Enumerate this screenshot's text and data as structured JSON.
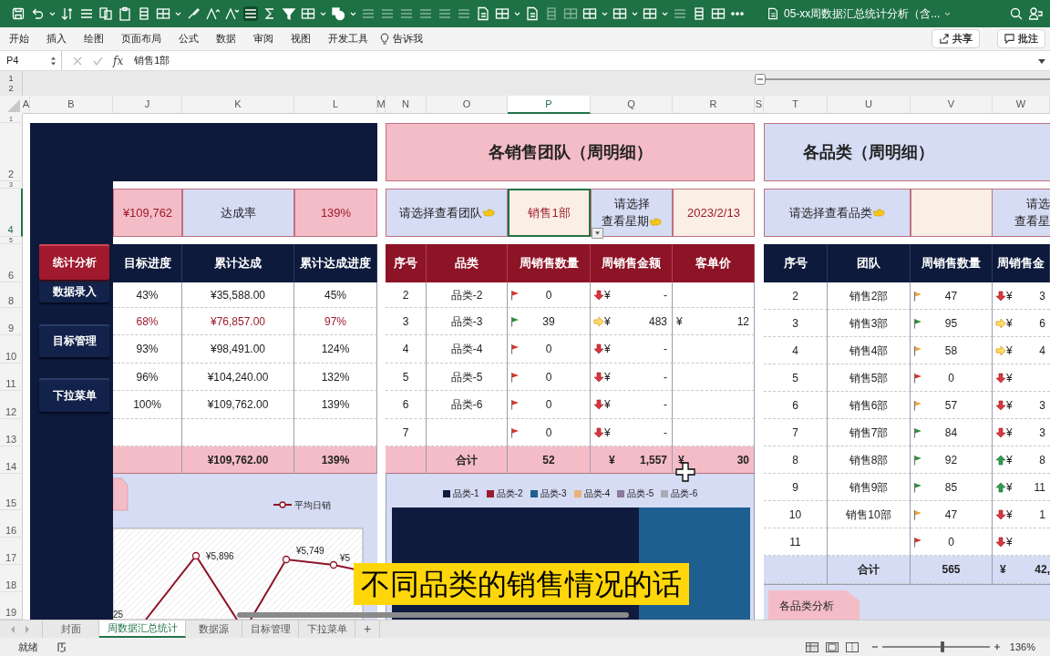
{
  "toolbar": {
    "file_title": "05-xx周数据汇总统计分析（含..."
  },
  "ribbon": {
    "tabs": [
      "开始",
      "插入",
      "绘图",
      "页面布局",
      "公式",
      "数据",
      "审阅",
      "视图",
      "开发工具"
    ],
    "tell_me": "告诉我",
    "share": "共享",
    "comments": "批注"
  },
  "formula_bar": {
    "name_box": "P4",
    "function_label": "fx",
    "formula": "销售1部"
  },
  "outline_levels": [
    "1",
    "2"
  ],
  "columns": [
    {
      "label": "A",
      "selected": false
    },
    {
      "label": "B",
      "selected": false
    },
    {
      "label": "J",
      "selected": false
    },
    {
      "label": "K",
      "selected": false
    },
    {
      "label": "L",
      "selected": false
    },
    {
      "label": "M",
      "selected": false
    },
    {
      "label": "N",
      "selected": false
    },
    {
      "label": "O",
      "selected": false
    },
    {
      "label": "P",
      "selected": true
    },
    {
      "label": "Q",
      "selected": false
    },
    {
      "label": "R",
      "selected": false
    },
    {
      "label": "S",
      "selected": false
    },
    {
      "label": "T",
      "selected": false
    },
    {
      "label": "U",
      "selected": false
    },
    {
      "label": "V",
      "selected": false
    },
    {
      "label": "W",
      "selected": false
    }
  ],
  "rows": [
    {
      "label": "1",
      "selected": false
    },
    {
      "label": "2",
      "selected": false
    },
    {
      "label": "3",
      "selected": false
    },
    {
      "label": "4",
      "selected": true
    },
    {
      "label": "5",
      "selected": false
    },
    {
      "label": "6",
      "selected": false
    },
    {
      "label": "8",
      "selected": false
    },
    {
      "label": "9",
      "selected": false
    },
    {
      "label": "10",
      "selected": false
    },
    {
      "label": "11",
      "selected": false
    },
    {
      "label": "12",
      "selected": false
    },
    {
      "label": "13",
      "selected": false
    },
    {
      "label": "14",
      "selected": false
    },
    {
      "label": "15",
      "selected": false
    },
    {
      "label": "16",
      "selected": false
    },
    {
      "label": "17",
      "selected": false
    },
    {
      "label": "18",
      "selected": false
    },
    {
      "label": "19",
      "selected": false
    }
  ],
  "nav_buttons": [
    {
      "label": "统计分析",
      "selected": true
    },
    {
      "label": "数据录入",
      "selected": false
    },
    {
      "label": "目标管理",
      "selected": false
    },
    {
      "label": "下拉菜单",
      "selected": false
    }
  ],
  "target_panel": {
    "amount": "¥109,762",
    "rate_label": "达成率",
    "rate": "139%",
    "columns": [
      "目标进度",
      "累计达成",
      "累计达成进度"
    ],
    "rows": [
      {
        "cells": [
          "43%",
          "¥35,588.00",
          "45%"
        ],
        "highlighted": false
      },
      {
        "cells": [
          "68%",
          "¥76,857.00",
          "97%"
        ],
        "highlighted": true
      },
      {
        "cells": [
          "93%",
          "¥98,491.00",
          "124%"
        ],
        "highlighted": false
      },
      {
        "cells": [
          "96%",
          "¥104,240.00",
          "132%"
        ],
        "highlighted": false
      },
      {
        "cells": [
          "100%",
          "¥109,762.00",
          "139%"
        ],
        "highlighted": false
      },
      {
        "cells": []
      }
    ],
    "total": {
      "achieved": "¥109,762.00",
      "progress": "139%"
    },
    "chart": {
      "legend": "平均日销",
      "labels": [
        "¥5,896",
        "¥5,749",
        "¥5",
        "25"
      ]
    }
  },
  "team_panel": {
    "title": "各销售团队（周明细）",
    "team_label": "请选择查看团队",
    "team_value": {
      "text": "销售1部",
      "selected": true
    },
    "week_label": [
      "请选择",
      "查看星期"
    ],
    "week_value": "2023/2/13",
    "columns": [
      "序号",
      "品类",
      "周销售数量",
      "周销售金额",
      "客单价"
    ],
    "rows": [
      {
        "no": "2",
        "name": "品类-2",
        "flag": {
          "color": "#d6332b"
        },
        "qty": "0",
        "trend": {
          "kind": "down"
        },
        "currency": "¥",
        "amount": "-"
      },
      {
        "no": "3",
        "name": "品类-3",
        "flag": {
          "color": "#2e8b3a"
        },
        "qty": "39",
        "trend": {
          "kind": "right"
        },
        "currency": "¥",
        "amount": "483",
        "price_currency": "¥",
        "price": "12"
      },
      {
        "no": "4",
        "name": "品类-4",
        "flag": {
          "color": "#d6332b"
        },
        "qty": "0",
        "trend": {
          "kind": "down"
        },
        "currency": "¥",
        "amount": "-"
      },
      {
        "no": "5",
        "name": "品类-5",
        "flag": {
          "color": "#d6332b"
        },
        "qty": "0",
        "trend": {
          "kind": "down"
        },
        "currency": "¥",
        "amount": "-"
      },
      {
        "no": "6",
        "name": "品类-6",
        "flag": {
          "color": "#d6332b"
        },
        "qty": "0",
        "trend": {
          "kind": "down"
        },
        "currency": "¥",
        "amount": "-"
      },
      {
        "no": "7",
        "flag": {
          "color": "#d6332b"
        },
        "qty": "0",
        "trend": {
          "kind": "down"
        },
        "currency": "¥",
        "amount": "-"
      }
    ],
    "total": {
      "label": "合计",
      "qty": "52",
      "currency": "¥",
      "amount": "1,557",
      "price_currency": "¥",
      "price": "30"
    },
    "legend": [
      {
        "label": "品类-1",
        "color": "#101c3f"
      },
      {
        "label": "品类-2",
        "color": "#9b1b2e"
      },
      {
        "label": "品类-3",
        "color": "#1f5f8f"
      },
      {
        "label": "品类-4",
        "color": "#e8b27a"
      },
      {
        "label": "品类-5",
        "color": "#8c7b9c"
      },
      {
        "label": "品类-6",
        "color": "#a9adb3"
      }
    ]
  },
  "category_panel": {
    "title": "各品类（周明细）",
    "category_label": "请选择查看品类",
    "week_label": [
      "请选",
      "查看星"
    ],
    "columns": [
      "序号",
      "团队",
      "周销售数量",
      "周销售金"
    ],
    "rows": [
      {
        "no": "2",
        "team": "销售2部",
        "flag": {
          "color": "#e8a63a"
        },
        "qty": "47",
        "trend": {
          "kind": "down"
        },
        "currency": "¥",
        "amount": "3"
      },
      {
        "no": "3",
        "team": "销售3部",
        "flag": {
          "color": "#2e8b3a"
        },
        "qty": "95",
        "trend": {
          "kind": "right"
        },
        "currency": "¥",
        "amount": "6"
      },
      {
        "no": "4",
        "team": "销售4部",
        "flag": {
          "color": "#e8a63a"
        },
        "qty": "58",
        "trend": {
          "kind": "right"
        },
        "currency": "¥",
        "amount": "4"
      },
      {
        "no": "5",
        "team": "销售5部",
        "flag": {
          "color": "#d6332b"
        },
        "qty": "0",
        "trend": {
          "kind": "down"
        },
        "currency": "¥"
      },
      {
        "no": "6",
        "team": "销售6部",
        "flag": {
          "color": "#e8a63a"
        },
        "qty": "57",
        "trend": {
          "kind": "down"
        },
        "currency": "¥",
        "amount": "3"
      },
      {
        "no": "7",
        "team": "销售7部",
        "flag": {
          "color": "#2e8b3a"
        },
        "qty": "84",
        "trend": {
          "kind": "down"
        },
        "currency": "¥",
        "amount": "3"
      },
      {
        "no": "8",
        "team": "销售8部",
        "flag": {
          "color": "#2e8b3a"
        },
        "qty": "92",
        "trend": {
          "kind": "up"
        },
        "currency": "¥",
        "amount": "8"
      },
      {
        "no": "9",
        "team": "销售9部",
        "flag": {
          "color": "#2e8b3a"
        },
        "qty": "85",
        "trend": {
          "kind": "up"
        },
        "currency": "¥",
        "amount": "11"
      },
      {
        "no": "10",
        "team": "销售10部",
        "flag": {
          "color": "#e8a63a"
        },
        "qty": "47",
        "trend": {
          "kind": "down"
        },
        "currency": "¥",
        "amount": "1"
      },
      {
        "no": "11",
        "flag": {
          "color": "#d6332b"
        },
        "qty": "0",
        "trend": {
          "kind": "down"
        },
        "currency": "¥"
      }
    ],
    "total": {
      "label": "合计",
      "qty": "565",
      "currency": "¥",
      "amount": "42,"
    },
    "tab": "各品类分析"
  },
  "caption": "不同品类的销售情况的话",
  "sheet_tabs": [
    {
      "label": "封面",
      "selected": false
    },
    {
      "label": "周数据汇总统计",
      "selected": true
    },
    {
      "label": "数据源",
      "selected": false
    },
    {
      "label": "目标管理",
      "selected": false
    },
    {
      "label": "下拉菜单",
      "selected": false
    }
  ],
  "add_sheet": "+",
  "status": {
    "ready": "就绪",
    "zoom": "136%"
  },
  "zoom_slider": {
    "level": 0.56
  }
}
